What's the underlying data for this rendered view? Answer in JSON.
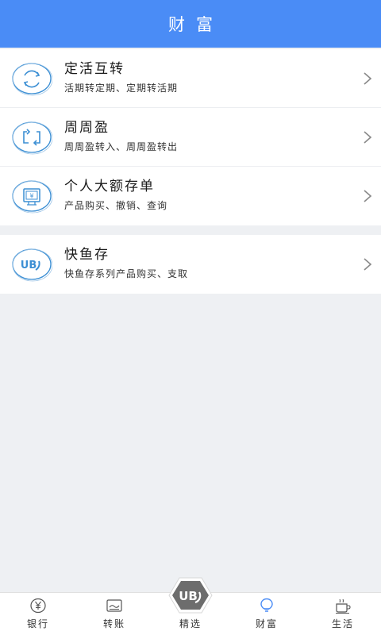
{
  "header": {
    "title": "财富"
  },
  "groups": [
    {
      "items": [
        {
          "icon": "exchange-cycle-icon",
          "title": "定活互转",
          "subtitle": "活期转定期、定期转活期"
        },
        {
          "icon": "weekly-transfer-icon",
          "title": "周周盈",
          "subtitle": "周周盈转入、周周盈转出"
        },
        {
          "icon": "deposit-certificate-icon",
          "title": "个人大额存单",
          "subtitle": "产品购买、撤销、查询"
        }
      ]
    },
    {
      "items": [
        {
          "icon": "ub-logo-icon",
          "title": "快鱼存",
          "subtitle": "快鱼存系列产品购买、支取"
        }
      ]
    }
  ],
  "tabbar": {
    "tabs": [
      {
        "icon": "yuan-coin-icon",
        "label": "银行"
      },
      {
        "icon": "card-icon",
        "label": "转账"
      },
      {
        "icon": "ub-badge-icon",
        "label": "精选"
      },
      {
        "icon": "lightbulb-icon",
        "label": "财富",
        "active": true
      },
      {
        "icon": "coffee-cup-icon",
        "label": "生活"
      }
    ]
  },
  "colors": {
    "header_bg": "#4a8cf6",
    "icon_blue": "#3c8fd4",
    "active_tab": "#4a8cf6",
    "page_bg": "#eef0f3"
  }
}
